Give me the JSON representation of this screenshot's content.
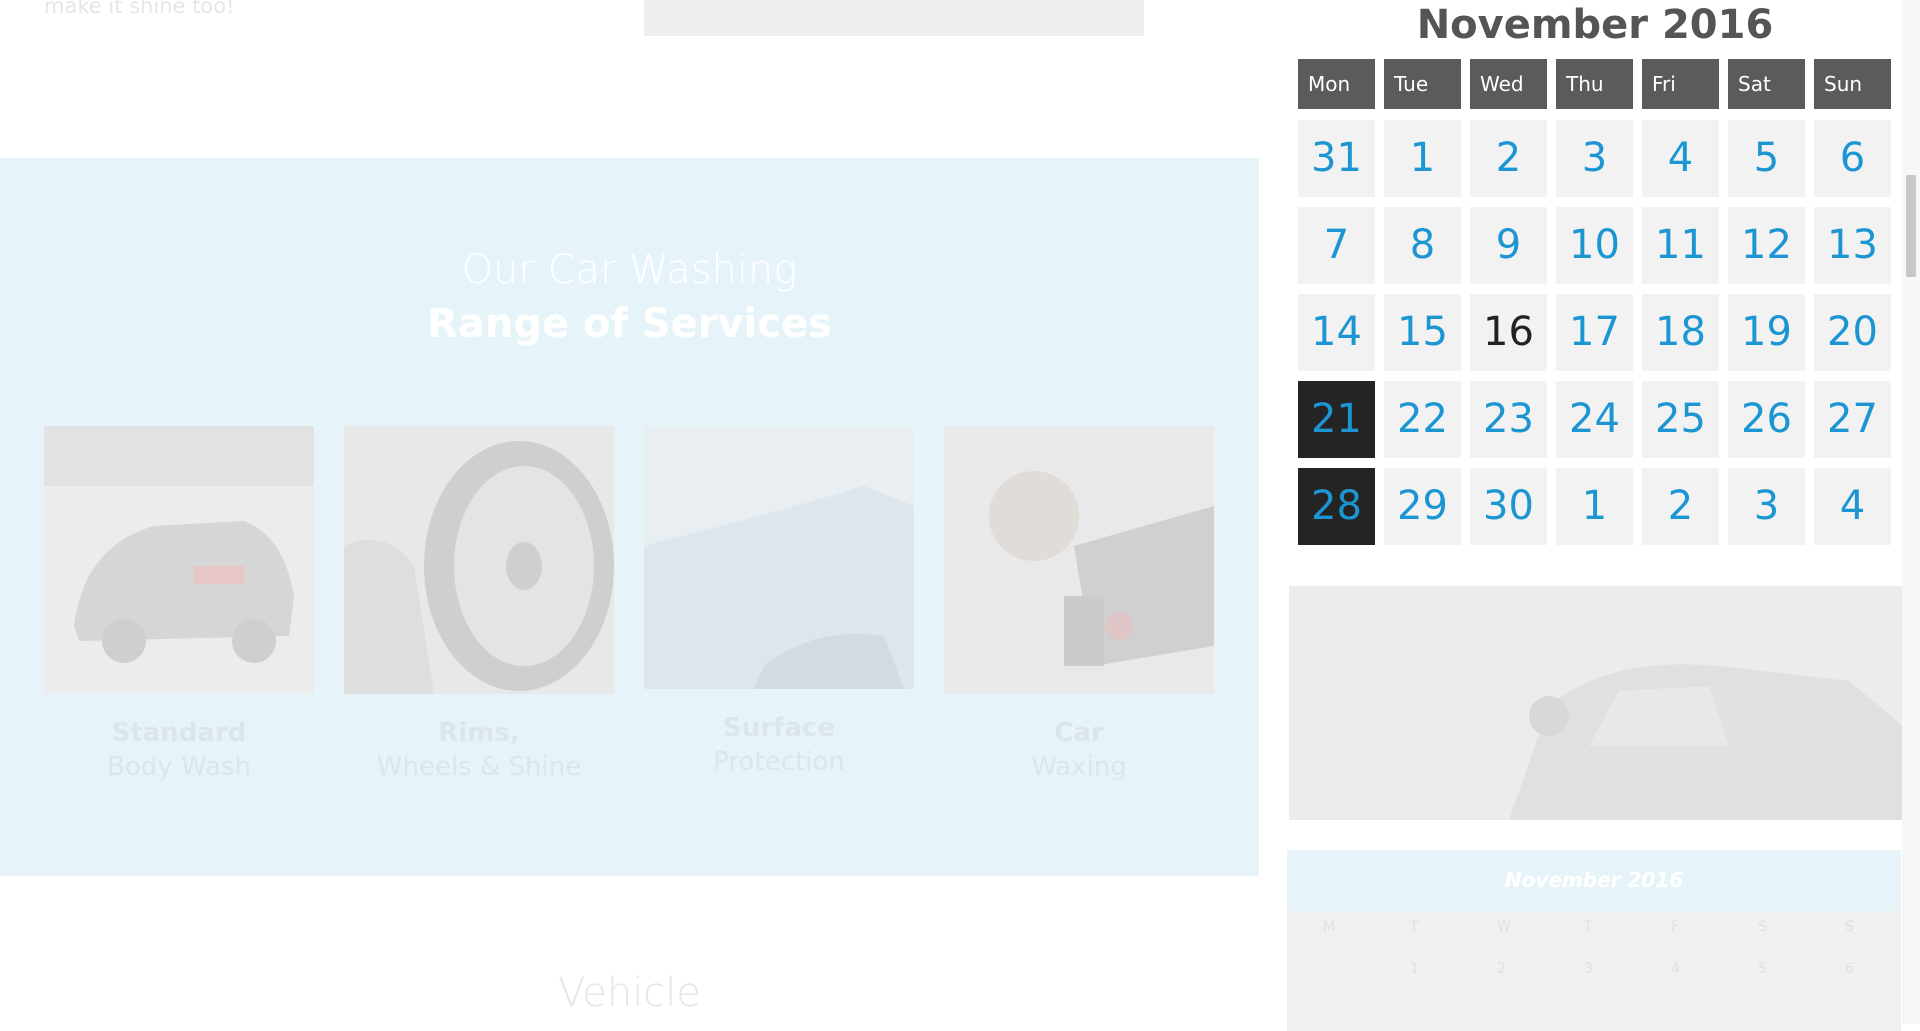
{
  "page": {
    "intro_text": "make it shine too!",
    "services": {
      "heading_light": "Our Car Washing",
      "heading_bold": "Range of Services",
      "cards": [
        {
          "title": "Standard",
          "subtitle": "Body Wash"
        },
        {
          "title": "Rims,",
          "subtitle": "Wheels & Shine"
        },
        {
          "title": "Surface",
          "subtitle": "Protection"
        },
        {
          "title": "Car",
          "subtitle": "Waxing"
        }
      ]
    },
    "vehicle_heading": "Vehicle"
  },
  "calendar": {
    "title": "November 2016",
    "weekdays": [
      "Mon",
      "Tue",
      "Wed",
      "Thu",
      "Fri",
      "Sat",
      "Sun"
    ],
    "weeks": [
      [
        "31",
        "1",
        "2",
        "3",
        "4",
        "5",
        "6"
      ],
      [
        "7",
        "8",
        "9",
        "10",
        "11",
        "12",
        "13"
      ],
      [
        "14",
        "15",
        "16",
        "17",
        "18",
        "19",
        "20"
      ],
      [
        "21",
        "22",
        "23",
        "24",
        "25",
        "26",
        "27"
      ],
      [
        "28",
        "29",
        "30",
        "1",
        "2",
        "3",
        "4"
      ]
    ],
    "today": "16",
    "selected": [
      "21",
      "28"
    ],
    "colors": {
      "day": "#1c96d2",
      "header_bg": "#5a5c5c",
      "selected_bg": "#242424",
      "cell_bg": "#f2f2f2"
    }
  },
  "mini_calendar": {
    "title": "November 2016",
    "weekdays": [
      "M",
      "T",
      "W",
      "T",
      "F",
      "S",
      "S"
    ],
    "first_row": [
      "",
      "1",
      "2",
      "3",
      "4",
      "5",
      "6"
    ]
  }
}
